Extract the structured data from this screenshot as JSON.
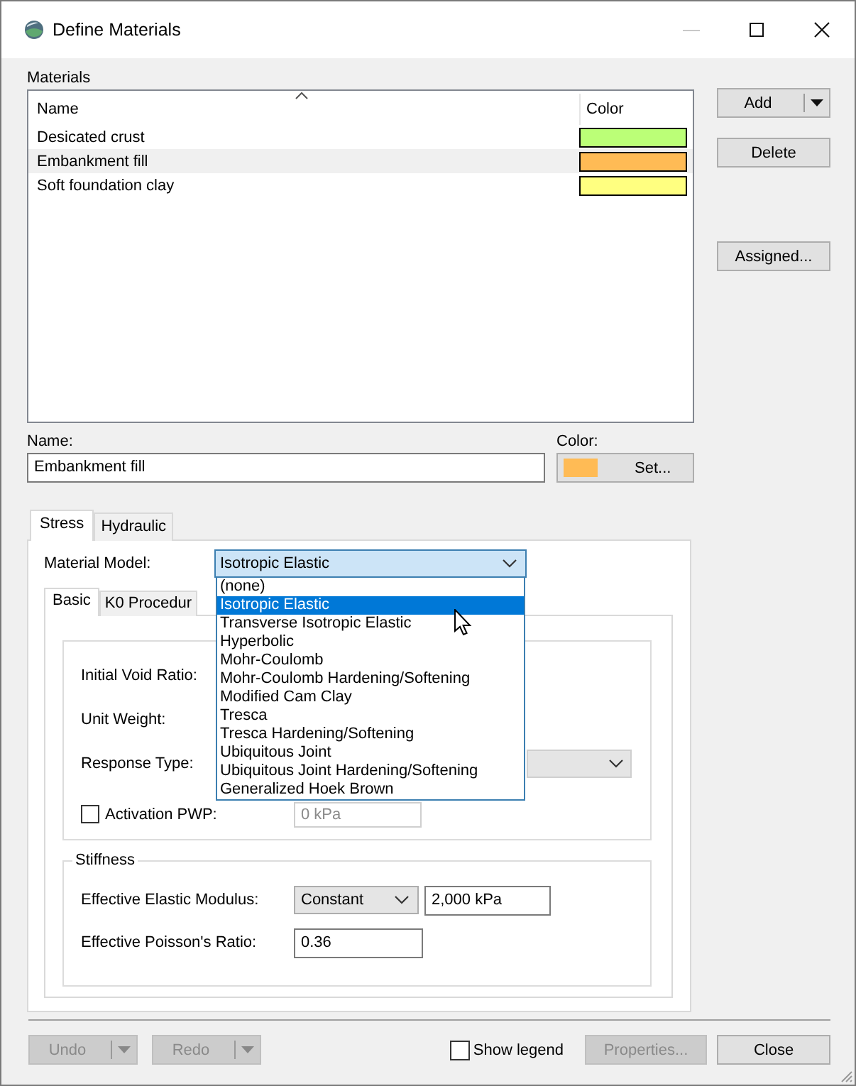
{
  "window": {
    "title": "Define Materials"
  },
  "materials": {
    "label": "Materials",
    "columns": [
      "Name",
      "Color"
    ],
    "rows": [
      {
        "name": "Desicated crust",
        "color": "#bbff77",
        "selected": false
      },
      {
        "name": "Embankment fill",
        "color": "#ffbb55",
        "selected": true
      },
      {
        "name": "Soft foundation clay",
        "color": "#ffff80",
        "selected": false
      }
    ]
  },
  "side_buttons": [
    {
      "label": "Add",
      "kind": "split"
    },
    {
      "label": "Delete",
      "kind": "plain"
    },
    {
      "label": "Assigned...",
      "kind": "plain"
    }
  ],
  "name_field": {
    "label": "Name:",
    "value": "Embankment fill"
  },
  "color_field": {
    "label": "Color:",
    "color": "#ffbb55",
    "button": "Set..."
  },
  "tabs": [
    {
      "label": "Stress",
      "selected": true
    },
    {
      "label": "Hydraulic",
      "selected": false
    }
  ],
  "material_model": {
    "label": "Material Model:",
    "value": "Isotropic Elastic",
    "expanded": true,
    "options": [
      {
        "label": "(none)",
        "selected": false
      },
      {
        "label": "Isotropic Elastic",
        "selected": true
      },
      {
        "label": "Transverse Isotropic Elastic",
        "selected": false
      },
      {
        "label": "Hyperbolic",
        "selected": false
      },
      {
        "label": "Mohr-Coulomb",
        "selected": false
      },
      {
        "label": "Mohr-Coulomb Hardening/Softening",
        "selected": false
      },
      {
        "label": "Modified Cam Clay",
        "selected": false
      },
      {
        "label": "Tresca",
        "selected": false
      },
      {
        "label": "Tresca Hardening/Softening",
        "selected": false
      },
      {
        "label": "Ubiquitous Joint",
        "selected": false
      },
      {
        "label": "Ubiquitous Joint Hardening/Softening",
        "selected": false
      },
      {
        "label": "Generalized Hoek Brown",
        "selected": false
      }
    ]
  },
  "subtabs": [
    {
      "label": "Basic",
      "selected": true
    },
    {
      "label": "K0 Procedur",
      "selected": false
    }
  ],
  "basic": {
    "rows": [
      {
        "kind": "label",
        "label": "Initial Void Ratio:"
      },
      {
        "kind": "label",
        "label": "Unit Weight:"
      },
      {
        "kind": "combo",
        "label": "Response Type:",
        "disabled": true
      },
      {
        "kind": "checkbox",
        "label": "Activation PWP:",
        "checked": false,
        "value": "0 kPa",
        "disabled": true
      }
    ]
  },
  "stiffness": {
    "title": "Stiffness",
    "rows": [
      {
        "kind": "combo_field",
        "label": "Effective Elastic Modulus:",
        "option": "Constant",
        "value": "2,000 kPa"
      },
      {
        "kind": "field",
        "label": "Effective Poisson's Ratio:",
        "value": "0.36"
      }
    ]
  },
  "footer": {
    "undo": {
      "label": "Undo",
      "disabled": true
    },
    "redo": {
      "label": "Redo",
      "disabled": true
    },
    "show_legend": {
      "label": "Show legend",
      "checked": false
    },
    "properties": {
      "label": "Properties...",
      "disabled": true
    },
    "close": {
      "label": "Close",
      "disabled": false
    }
  }
}
